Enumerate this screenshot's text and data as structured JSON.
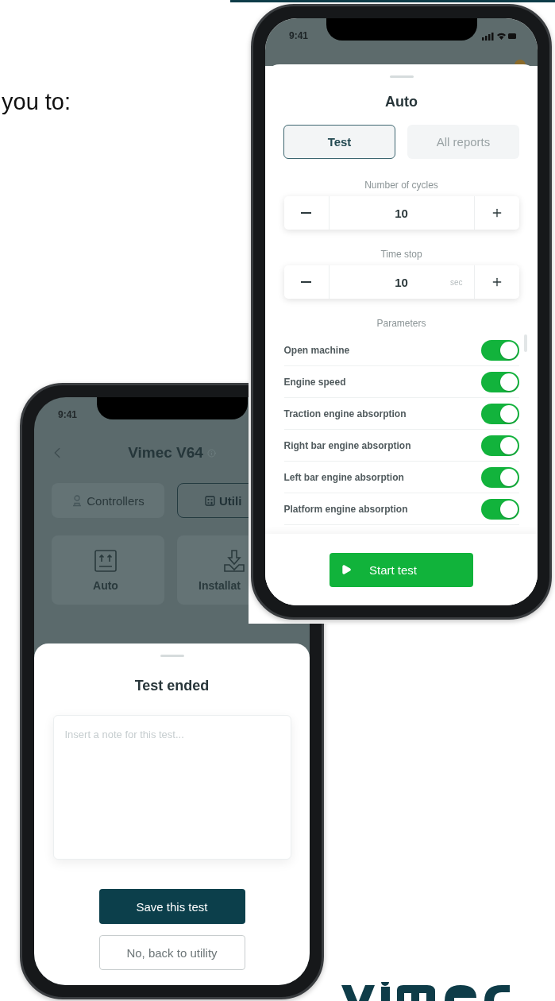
{
  "slide": {
    "caption": "you to:"
  },
  "utility_phone": {
    "status_time": "9:41",
    "title": "Vimec V64",
    "tabs": [
      {
        "label": "Controllers",
        "selected": false
      },
      {
        "label": "Utili",
        "selected": true
      }
    ],
    "cards": [
      {
        "label": "Auto"
      },
      {
        "label": "Installat"
      }
    ],
    "sheet": {
      "title": "Test ended",
      "note": {
        "placeholder": "Insert a note for this test..."
      },
      "buttons": [
        {
          "label": "Save this test",
          "kind": "primary"
        },
        {
          "label": "No, back to utility",
          "kind": "secondary"
        }
      ]
    }
  },
  "auto_phone": {
    "status_time": "9:41",
    "sheet": {
      "title": "Auto",
      "tabs": [
        {
          "label": "Test",
          "selected": true
        },
        {
          "label": "All reports",
          "selected": false
        }
      ],
      "steppers": [
        {
          "label": "Number of cycles",
          "value": "10"
        },
        {
          "label": "Time stop",
          "value": "10",
          "unit": "sec"
        }
      ],
      "parameters_title": "Parameters",
      "parameters": [
        {
          "label": "Open machine",
          "on": true
        },
        {
          "label": "Engine speed",
          "on": true
        },
        {
          "label": "Traction engine absorption",
          "on": true
        },
        {
          "label": "Right bar engine absorption",
          "on": true
        },
        {
          "label": "Left bar engine absorption",
          "on": true
        },
        {
          "label": "Platform engine absorption",
          "on": true
        }
      ],
      "start_button": "Start test"
    }
  }
}
